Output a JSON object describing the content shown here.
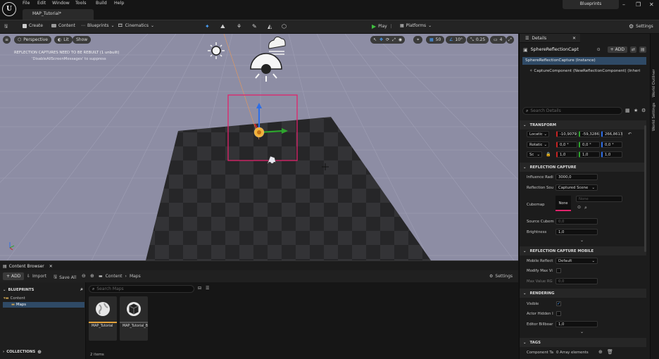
{
  "menu": [
    "File",
    "Edit",
    "Window",
    "Tools",
    "Build",
    "Help"
  ],
  "level_tab": "MAP_Tutorial",
  "top_badge": "Blueprints",
  "toolbar": {
    "create": "Create",
    "content": "Content",
    "blueprints": "Blueprints",
    "cinematics": "Cinematics",
    "play": "Play",
    "platforms": "Platforms",
    "settings": "Settings"
  },
  "viewport": {
    "perspective": "Perspective",
    "lit": "Lit",
    "show": "Show",
    "warning_1": "REFLECTION CAPTURES NEED TO BE REBUILT (1 unbuilt)",
    "warning_2": "'DisableAllScreenMessages' to suppress",
    "grid_snap": "50",
    "rot_snap": "10°",
    "scale_snap": "0.25",
    "cam_speed": "4",
    "colors": {
      "sky": "#8d8da4",
      "floor_dark": "#262628",
      "floor_light": "#333336",
      "selection": "#e0236b"
    }
  },
  "details": {
    "tab": "Details",
    "actor_name": "SphereReflectionCapt",
    "add_button": "ADD",
    "instance_row": "SphereReflectionCapture (Instance)",
    "component_row": "CaptureComponent (NewReflectionComponent) (Inheri",
    "search_placeholder": "Search Details",
    "sections": {
      "transform": "TRANSFORM",
      "reflection_capture": "REFLECTION CAPTURE",
      "reflection_capture_mobile": "REFLECTION CAPTURE MOBILE",
      "rendering": "RENDERING",
      "tags": "TAGS"
    },
    "transform": {
      "location_label": "Locatic",
      "rotation_label": "Rotatic",
      "scale_label": "Sc",
      "location": [
        "-10,9079",
        "-59,3286",
        "266,8613"
      ],
      "rotation": [
        "0,0 °",
        "0,0 °",
        "0,0 °"
      ],
      "scale": [
        "1,0",
        "1,0",
        "1,0"
      ]
    },
    "reflection": {
      "influence_label": "Influence Radi",
      "influence_value": "3000,0",
      "source_label": "Reflection Sou",
      "source_value": "Captured Scene",
      "cubemap_label": "Cubemap",
      "cubemap_none": "None",
      "cubemap_select": "None",
      "source_cubemap_label": "Source Cubem",
      "source_cubemap_value": "0,0",
      "brightness_label": "Brightness",
      "brightness_value": "1,0"
    },
    "mobile": {
      "mobile_reflect_label": "Mobile Reflect",
      "mobile_reflect_value": "Default",
      "modify_max_label": "Modify Max Vi",
      "max_value_label": "Max Value RG",
      "max_value_value": "0,0"
    },
    "rendering": {
      "visible_label": "Visible",
      "actor_hidden_label": "Actor Hidden I",
      "editor_billboard_label": "Editor Billboar",
      "editor_billboard_value": "1,0"
    },
    "tags": {
      "component_tags_label": "Component Ta",
      "component_tags_value": "0 Array elements"
    }
  },
  "right_strip": {
    "world_outliner": "World Outliner",
    "world_settings": "World Settings"
  },
  "content_browser": {
    "tab": "Content Browser",
    "add": "ADD",
    "import": "Import",
    "save_all": "Save All",
    "breadcrumb": [
      "Content",
      "Maps"
    ],
    "settings": "Settings",
    "favorites_header": "BLUEPRINTS",
    "tree_root": "Content",
    "tree_child": "Maps",
    "search_placeholder": "Search Maps",
    "collections": "COLLECTIONS",
    "items_count": "2 items",
    "assets": [
      {
        "name": "MAP_Tutorial",
        "icon": "globe-icon"
      },
      {
        "name": "MAP_Tutorial_BuiltData",
        "icon": "sphere-icon"
      }
    ]
  }
}
